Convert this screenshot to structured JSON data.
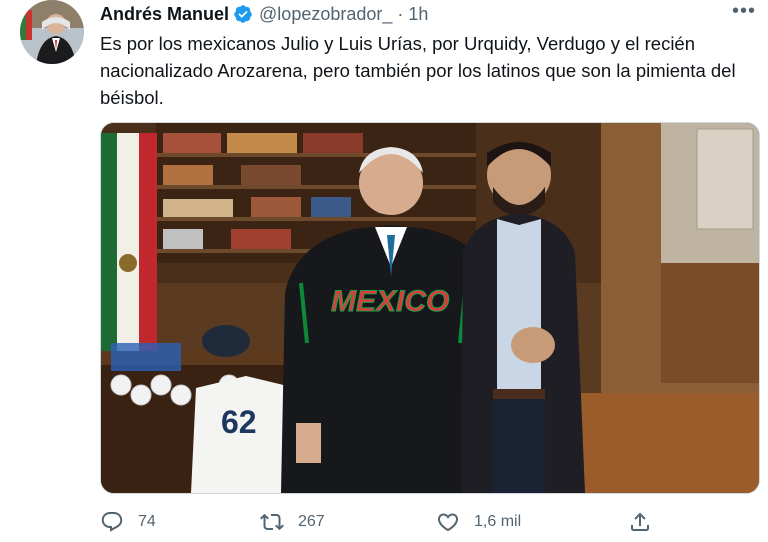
{
  "tweet": {
    "display_name": "Andrés Manuel",
    "handle": "@lopezobrador_",
    "separator": "·",
    "time": "1h",
    "more": "•••",
    "text": "Es por los mexicanos Julio y Luis Urías, por Urquidy, Verdugo y el recién nacionalizado Arozarena, pero también por los latinos que son la pimienta del béisbol.",
    "jacket_text": "MEXICO",
    "jersey_number": "62",
    "actions": {
      "replies": "74",
      "retweets": "267",
      "likes": "1,6 mil"
    }
  },
  "icons": {
    "verified": "verified-badge-icon",
    "reply": "reply-icon",
    "retweet": "retweet-icon",
    "like": "heart-icon",
    "share": "share-icon",
    "more": "more-dots-icon"
  },
  "colors": {
    "verified": "#1d9bf0",
    "text": "#0f1419",
    "muted": "#536471"
  }
}
